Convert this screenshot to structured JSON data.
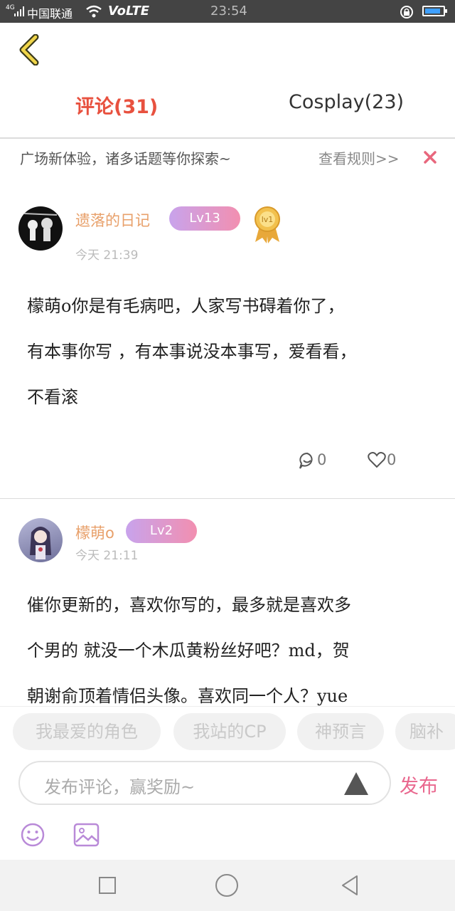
{
  "status_bar": {
    "signal_label": "4G",
    "carrier": "中国联通",
    "volte": "VoLTE",
    "time": "23:54"
  },
  "tabs": [
    {
      "label": "评论(31)",
      "active": true
    },
    {
      "label": "Cosplay(23)",
      "active": false
    }
  ],
  "notice": {
    "text": "广场新体验，诸多话题等你探索~",
    "link": "查看规则>>"
  },
  "comments": [
    {
      "username": "遗落的日记",
      "level": "Lv13",
      "medal": "lv1",
      "time": "今天 21:39",
      "lines": [
        "檬萌o你是有毛病吧，人家写书碍着你了，",
        "有本事你写 ，有本事说没本事写，爱看看，",
        "不看滚"
      ],
      "replies": "0",
      "likes": "0"
    },
    {
      "username": "檬萌o",
      "level": "Lv2",
      "time": "今天 21:11",
      "lines": [
        "催你更新的，喜欢你写的，最多就是喜欢多",
        "个男的 就没一个木瓜黄粉丝好吧？md，贺",
        "朝谢俞顶着情侣头像。喜欢同一个人？yue"
      ]
    }
  ],
  "topic_chips": [
    "我最爱的角色",
    "我站的CP",
    "神预言",
    "脑补"
  ],
  "comment_input": {
    "placeholder": "发布评论，赢奖励~"
  },
  "publish_label": "发布",
  "colors": {
    "accent_red": "#e8513f",
    "username": "#e8a06a",
    "publish": "#e9678e",
    "level_gradient_start": "#c8a3ec",
    "level_gradient_end": "#f28fb0"
  }
}
